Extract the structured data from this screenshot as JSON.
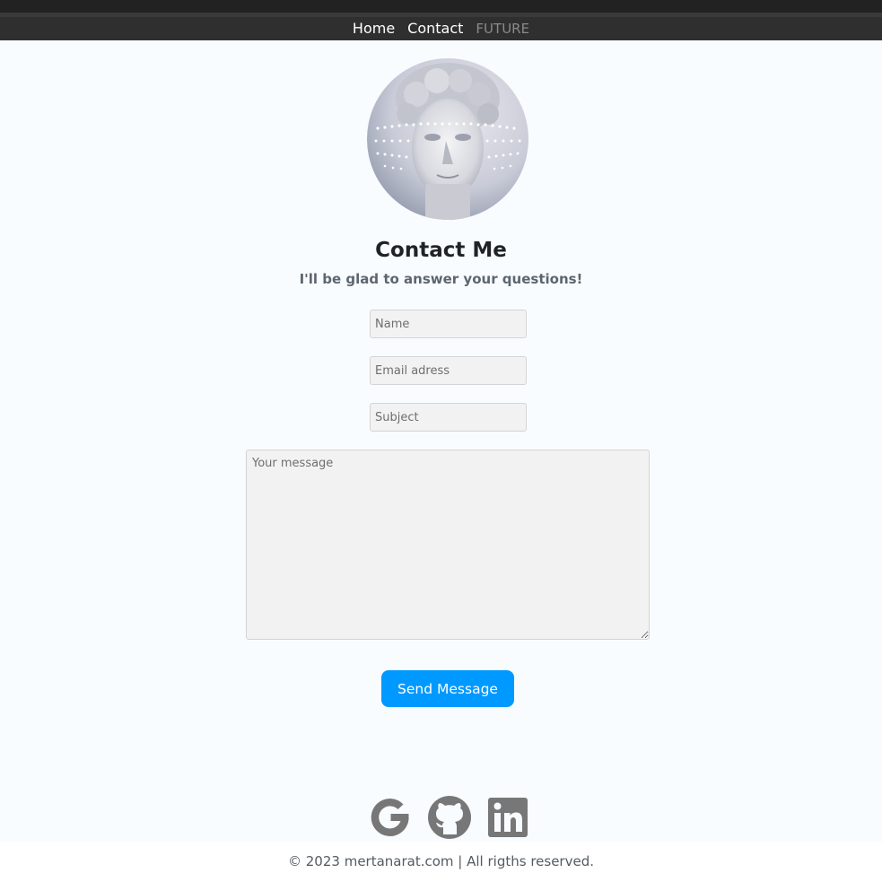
{
  "nav": {
    "items": [
      {
        "label": "Home"
      },
      {
        "label": "Contact"
      },
      {
        "label": "FUTURE"
      }
    ]
  },
  "contact": {
    "title": "Contact Me",
    "subtitle": "I'll be glad to answer your questions!",
    "name_placeholder": "Name",
    "email_placeholder": "Email adress",
    "subject_placeholder": "Subject",
    "message_placeholder": "Your message",
    "send_label": "Send Message"
  },
  "social": {
    "icons": [
      "google-icon",
      "github-icon",
      "linkedin-icon"
    ]
  },
  "footer": {
    "copyright": "© 2023 mertanarat.com | All rigths reserved."
  },
  "colors": {
    "accent": "#0099ff",
    "navbar": "#2f2f2f",
    "background": "#f8fcff",
    "icon": "#777777"
  }
}
